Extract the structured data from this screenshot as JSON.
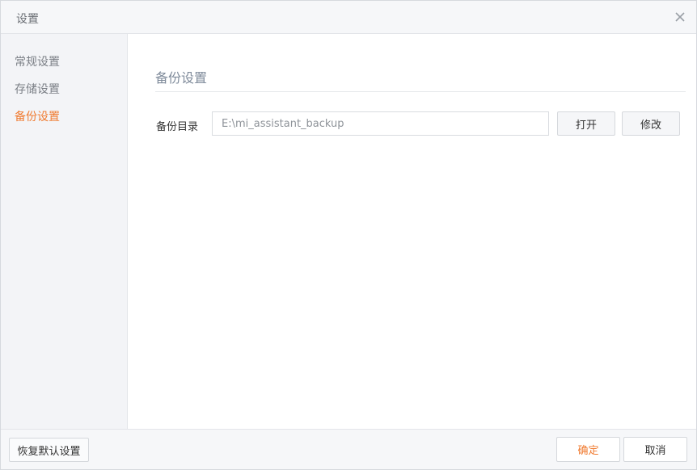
{
  "window": {
    "title": "设置"
  },
  "icons": {
    "close": "close-icon"
  },
  "sidebar": {
    "items": [
      {
        "label": "常规设置",
        "active": false
      },
      {
        "label": "存储设置",
        "active": false
      },
      {
        "label": "备份设置",
        "active": true
      }
    ]
  },
  "content": {
    "section_title": "备份设置",
    "backup_dir": {
      "label": "备份目录",
      "value": "E:\\mi_assistant_backup",
      "open_label": "打开",
      "change_label": "修改"
    }
  },
  "footer": {
    "reset_label": "恢复默认设置",
    "ok_label": "确定",
    "cancel_label": "取消"
  },
  "colors": {
    "accent": "#f07a2f",
    "sidebar_bg": "#f3f4f7",
    "section_title": "#7e8a9a"
  }
}
